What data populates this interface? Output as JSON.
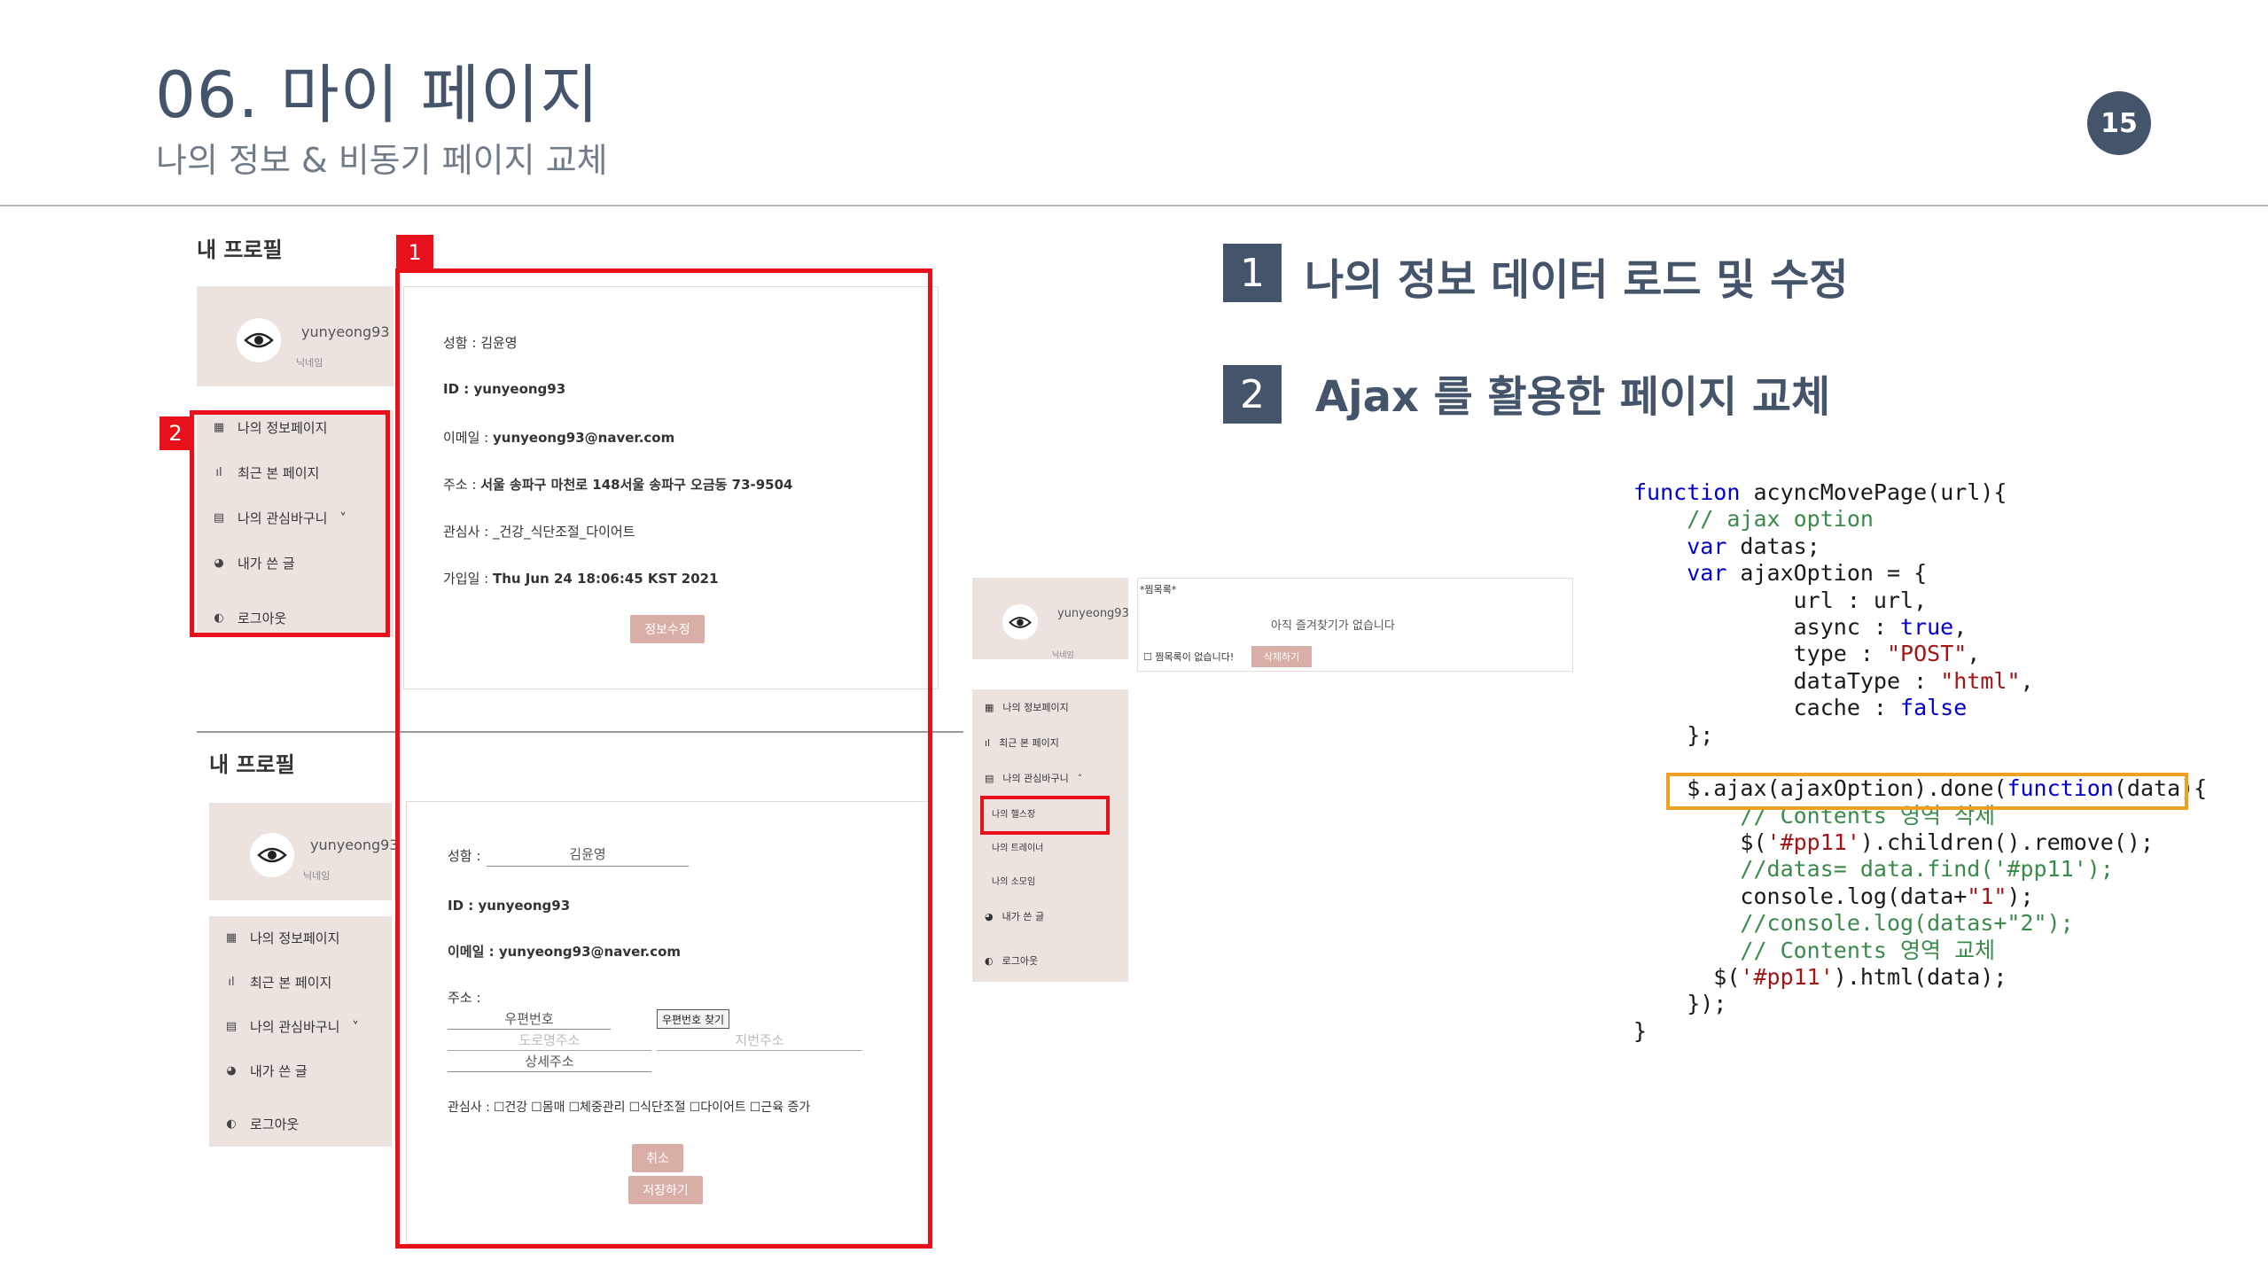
{
  "slide": {
    "title": "06. 마이 페이지",
    "subtitle": "나의 정보 & 비동기 페이지 교체",
    "page_number": "15"
  },
  "features": [
    {
      "num": "1",
      "text": "나의 정보 데이터 로드 및 수정"
    },
    {
      "num": "2",
      "text": "Ajax 를 활용한 페이지 교체"
    }
  ],
  "profile_view": {
    "title": "내 프로필",
    "username": "yunyeong93",
    "nickname": "닉네임",
    "nav": [
      {
        "icon": "grid-icon",
        "glyph": "▦",
        "label": "나의 정보페이지"
      },
      {
        "icon": "chart-icon",
        "glyph": "ıl",
        "label": "최근 본 페이지"
      },
      {
        "icon": "book-icon",
        "glyph": "▤",
        "label": "나의 관심바구니",
        "chevron": "˅"
      },
      {
        "icon": "palette-icon",
        "glyph": "◕",
        "label": "내가 쓴 글"
      },
      {
        "icon": "logout-icon",
        "glyph": "◐",
        "label": "로그아웃"
      }
    ],
    "fields": [
      {
        "label": "성함 : ",
        "value": "김윤영"
      },
      {
        "label": "ID : ",
        "value": "yunyeong93"
      },
      {
        "label": "이메일 : ",
        "value": "yunyeong93@naver.com"
      },
      {
        "label": "주소 : ",
        "value": "서울 송파구 마천로 148서울 송파구 오금동 73-9504"
      },
      {
        "label": "관심사 : ",
        "value": "_건강_식단조절_다이어트"
      },
      {
        "label": "가입일 : ",
        "value": "Thu Jun 24 18:06:45 KST 2021"
      }
    ],
    "edit_button": "정보수정"
  },
  "callouts": {
    "box1": "1",
    "box2": "2"
  },
  "profile_edit": {
    "title": "내 프로필",
    "username": "yunyeong93",
    "nickname": "닉네임",
    "nav": [
      {
        "icon": "grid-icon",
        "glyph": "▦",
        "label": "나의 정보페이지"
      },
      {
        "icon": "chart-icon",
        "glyph": "ıl",
        "label": "최근 본 페이지"
      },
      {
        "icon": "book-icon",
        "glyph": "▤",
        "label": "나의 관심바구니",
        "chevron": "˅"
      },
      {
        "icon": "palette-icon",
        "glyph": "◕",
        "label": "내가 쓴 글"
      },
      {
        "icon": "logout-icon",
        "glyph": "◐",
        "label": "로그아웃"
      }
    ],
    "name_label": "성함 :",
    "name_value": "김윤영",
    "id_line": "ID : yunyeong93",
    "email_line": "이메일 : yunyeong93@naver.com",
    "address_label": "주소 :",
    "postcode_placeholder": "우편번호",
    "find_postcode_button": "우편번호 찾기",
    "road_address_placeholder": "도로명주소",
    "jibun_address_placeholder": "지번주소",
    "detail_address_placeholder": "상세주소",
    "interest_label": "관심사 :",
    "interests": [
      "건강",
      "몸매",
      "체중관리",
      "식단조절",
      "다이어트",
      "근육 증가"
    ],
    "cancel_button": "취소",
    "save_button": "저장하기"
  },
  "mini_app": {
    "username": "yunyeong93",
    "nickname": "닉네임",
    "favorites_title": "*찜목록*",
    "empty_message": "아직 즐겨찾기가 없습니다",
    "no_favorites_checkbox": "찜목록이 없습니다!",
    "delete_button": "삭제하기",
    "nav": [
      {
        "icon": "grid-icon",
        "glyph": "▦",
        "label": "나의 정보페이지"
      },
      {
        "icon": "chart-icon",
        "glyph": "ıl",
        "label": "최근 본 페이지"
      },
      {
        "icon": "book-icon",
        "glyph": "▤",
        "label": "나의 관심바구니",
        "chevron": "˄"
      }
    ],
    "sub_items": [
      "나의 헬스장",
      "나의 트레이너",
      "나의 소모임"
    ],
    "nav_bottom": [
      {
        "icon": "palette-icon",
        "glyph": "◕",
        "label": "내가 쓴 글"
      },
      {
        "icon": "logout-icon",
        "glyph": "◐",
        "label": "로그아웃"
      }
    ]
  },
  "code": {
    "lines": [
      [
        {
          "t": "function",
          "c": "kw"
        },
        {
          "t": " acyncMovePage(url){",
          "c": ""
        }
      ],
      [
        {
          "t": "    // ajax option",
          "c": "cm"
        }
      ],
      [
        {
          "t": "    ",
          "c": ""
        },
        {
          "t": "var",
          "c": "kw"
        },
        {
          "t": " datas;",
          "c": ""
        }
      ],
      [
        {
          "t": "    ",
          "c": ""
        },
        {
          "t": "var",
          "c": "kw"
        },
        {
          "t": " ajaxOption = {",
          "c": ""
        }
      ],
      [
        {
          "t": "            url : url,",
          "c": ""
        }
      ],
      [
        {
          "t": "            async : ",
          "c": ""
        },
        {
          "t": "true",
          "c": "kw"
        },
        {
          "t": ",",
          "c": ""
        }
      ],
      [
        {
          "t": "            type : ",
          "c": ""
        },
        {
          "t": "\"POST\"",
          "c": "st"
        },
        {
          "t": ",",
          "c": ""
        }
      ],
      [
        {
          "t": "            dataType : ",
          "c": ""
        },
        {
          "t": "\"html\"",
          "c": "st"
        },
        {
          "t": ",",
          "c": ""
        }
      ],
      [
        {
          "t": "            cache : ",
          "c": ""
        },
        {
          "t": "false",
          "c": "kw"
        }
      ],
      [
        {
          "t": "    };",
          "c": ""
        }
      ],
      [
        {
          "t": "",
          "c": ""
        }
      ],
      [
        {
          "t": "    $.ajax(ajaxOption).done(",
          "c": ""
        },
        {
          "t": "function",
          "c": "kw"
        },
        {
          "t": "(data){",
          "c": ""
        }
      ],
      [
        {
          "t": "        // Contents 영역 삭제",
          "c": "cm"
        }
      ],
      [
        {
          "t": "        $(",
          "c": ""
        },
        {
          "t": "'#pp11'",
          "c": "st"
        },
        {
          "t": ").children().remove();",
          "c": ""
        }
      ],
      [
        {
          "t": "        //datas= data.find('#pp11');",
          "c": "cm"
        }
      ],
      [
        {
          "t": "        console.log(data+",
          "c": ""
        },
        {
          "t": "\"1\"",
          "c": "st"
        },
        {
          "t": ");",
          "c": ""
        }
      ],
      [
        {
          "t": "        //console.log(datas+\"2\");",
          "c": "cm"
        }
      ],
      [
        {
          "t": "        // Contents 영역 교체",
          "c": "cm"
        }
      ],
      [
        {
          "t": "      $(",
          "c": ""
        },
        {
          "t": "'#pp11'",
          "c": "st"
        },
        {
          "t": ").html(data);",
          "c": ""
        }
      ],
      [
        {
          "t": "    });",
          "c": ""
        }
      ],
      [
        {
          "t": "}",
          "c": ""
        }
      ]
    ]
  }
}
